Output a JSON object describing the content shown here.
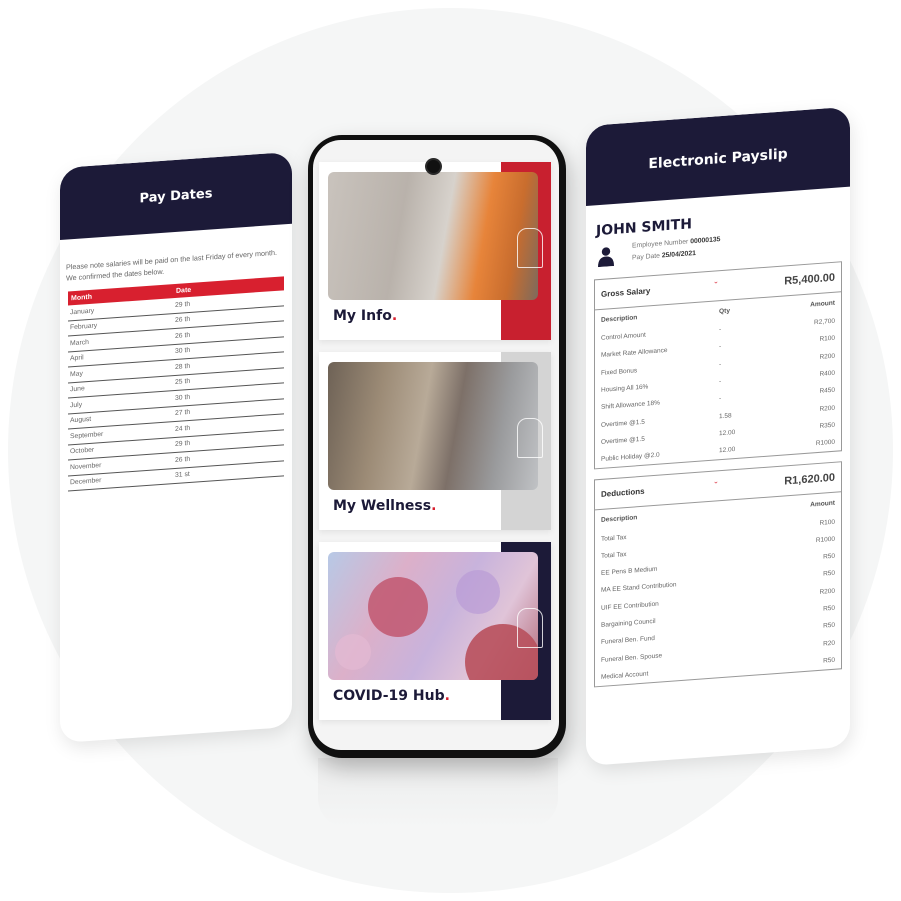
{
  "pay_dates": {
    "title": "Pay Dates",
    "note": "Please note salaries will be paid on the last Friday of every month. We confirmed the dates below.",
    "columns": [
      "Month",
      "Date"
    ],
    "rows": [
      {
        "month": "January",
        "date": "29 th"
      },
      {
        "month": "February",
        "date": "26 th"
      },
      {
        "month": "March",
        "date": "26 th"
      },
      {
        "month": "April",
        "date": "30 th"
      },
      {
        "month": "May",
        "date": "28 th"
      },
      {
        "month": "June",
        "date": "25 th"
      },
      {
        "month": "July",
        "date": "30 th"
      },
      {
        "month": "August",
        "date": "27 th"
      },
      {
        "month": "September",
        "date": "24 th"
      },
      {
        "month": "October",
        "date": "29 th"
      },
      {
        "month": "November",
        "date": "26 th"
      },
      {
        "month": "December",
        "date": "31 st"
      }
    ]
  },
  "phone": {
    "tiles": [
      {
        "label": "My Info",
        "dot": ".",
        "accent": "#c8202f",
        "icon": "outline-shape-icon"
      },
      {
        "label": "My Wellness",
        "dot": ".",
        "accent": "#d4d4d4",
        "icon": "outline-shape-icon"
      },
      {
        "label": "COVID-19 Hub",
        "dot": ".",
        "accent": "#1c1a38",
        "icon": "outline-shape-icon"
      }
    ]
  },
  "payslip": {
    "title": "Electronic Payslip",
    "employee_name": "JOHN SMITH",
    "employee_number_label": "Employee Number",
    "employee_number": "00000135",
    "pay_date_label": "Pay Date",
    "pay_date": "25/04/2021",
    "gross": {
      "title": "Gross Salary",
      "total": "R5,400.00",
      "columns": [
        "Description",
        "Qty",
        "Amount"
      ],
      "rows": [
        {
          "desc": "Control Amount",
          "qty": "-",
          "amount": "R2,700"
        },
        {
          "desc": "Market Rate Allowance",
          "qty": "-",
          "amount": "R100"
        },
        {
          "desc": "Fixed Bonus",
          "qty": "-",
          "amount": "R200"
        },
        {
          "desc": "Housing All 16%",
          "qty": "-",
          "amount": "R400"
        },
        {
          "desc": "Shift Allowance 18%",
          "qty": "-",
          "amount": "R450"
        },
        {
          "desc": "Overtime @1.5",
          "qty": "1.58",
          "amount": "R200"
        },
        {
          "desc": "Overtime @1.5",
          "qty": "12.00",
          "amount": "R350"
        },
        {
          "desc": "Public Holiday @2.0",
          "qty": "12.00",
          "amount": "R1000"
        }
      ]
    },
    "deductions": {
      "title": "Deductions",
      "total": "R1,620.00",
      "columns": [
        "Description",
        "Amount"
      ],
      "rows": [
        {
          "desc": "Total Tax",
          "amount": "R100"
        },
        {
          "desc": "Total Tax",
          "amount": "R1000"
        },
        {
          "desc": "EE Pens B Medium",
          "amount": "R50"
        },
        {
          "desc": "MA EE Stand Contribution",
          "amount": "R50"
        },
        {
          "desc": "UIF EE Contribution",
          "amount": "R200"
        },
        {
          "desc": "Bargaining Council",
          "amount": "R50"
        },
        {
          "desc": "Funeral Ben. Fund",
          "amount": "R50"
        },
        {
          "desc": "Funeral Ben. Spouse",
          "amount": "R20"
        },
        {
          "desc": "Medical Account",
          "amount": "R50"
        }
      ]
    }
  },
  "colors": {
    "navy": "#1c1a38",
    "red": "#d8202f"
  }
}
